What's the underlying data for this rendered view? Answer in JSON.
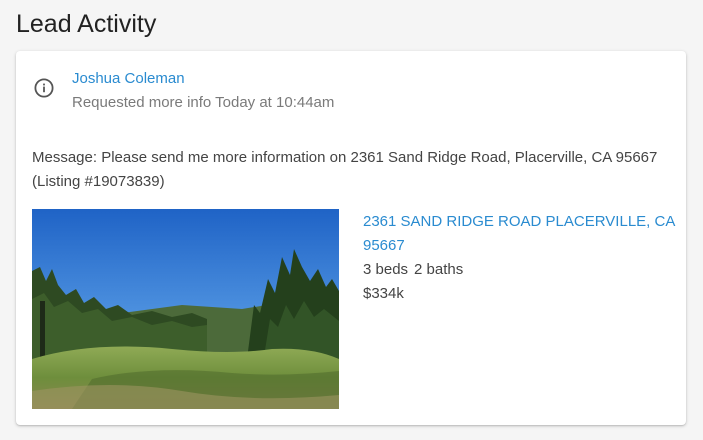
{
  "section": {
    "title": "Lead Activity"
  },
  "activity": {
    "icon": "info-circle-icon",
    "lead_name": "Joshua Coleman",
    "action_text": "Requested more info Today at 10:44am",
    "message": "Message: Please send me more information on 2361 Sand Ridge Road, Placerville, CA 95667 (Listing #19073839)"
  },
  "listing": {
    "address": "2361 SAND RIDGE ROAD PLACERVILLE, CA 95667",
    "beds": "3 beds",
    "baths": "2 baths",
    "price": "$334k"
  },
  "colors": {
    "link": "#2a8bd0",
    "muted_text": "#7a7a7a",
    "body_text": "#444444",
    "page_background": "#f5f5f5",
    "card_background": "#ffffff"
  }
}
